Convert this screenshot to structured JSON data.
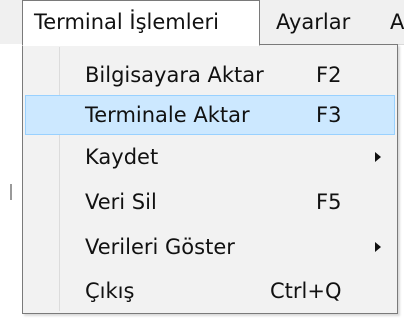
{
  "menubar": {
    "items": [
      {
        "label": "Terminal İşlemleri"
      },
      {
        "label": "Ayarlar"
      },
      {
        "label": "A"
      }
    ]
  },
  "dropdown": {
    "items": [
      {
        "label": "Bilgisayara Aktar",
        "shortcut": "F2"
      },
      {
        "label": "Terminale Aktar",
        "shortcut": "F3",
        "highlighted": true
      },
      {
        "label": "Kaydet",
        "submenu": true
      },
      {
        "label": "Veri Sil",
        "shortcut": "F5"
      },
      {
        "label": "Verileri Göster",
        "submenu": true
      },
      {
        "label": "Çıkış",
        "shortcut": "Ctrl+Q"
      }
    ]
  },
  "colors": {
    "highlight_bg": "#cce8ff",
    "highlight_border": "#99d1ff",
    "menu_bg": "#f2f2f2",
    "menubar_bg": "#f0f0f0",
    "text": "#111111"
  }
}
